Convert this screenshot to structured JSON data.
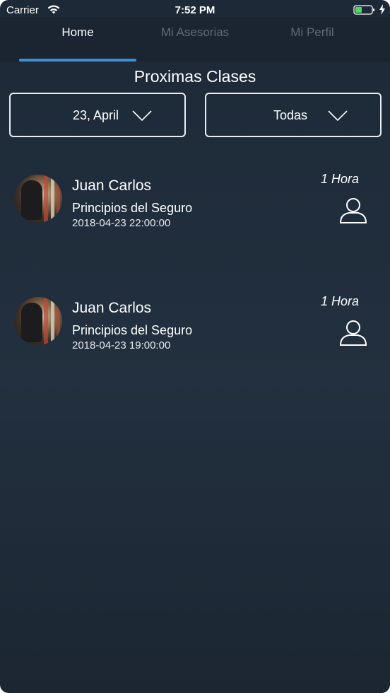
{
  "status_bar": {
    "carrier": "Carrier",
    "time": "7:52 PM",
    "icons": [
      "wifi-icon",
      "battery-icon",
      "charging-bolt-icon"
    ]
  },
  "tabs": [
    {
      "label": "Home",
      "active": true
    },
    {
      "label": "Mi Asesorias",
      "active": false
    },
    {
      "label": "Mi Perfil",
      "active": false
    }
  ],
  "page_title": "Proximas Clases",
  "filters": {
    "date": {
      "value": "23, April",
      "icon": "chevron-down-icon"
    },
    "category": {
      "value": "Todas",
      "icon": "chevron-down-icon"
    }
  },
  "classes": [
    {
      "teacher": "Juan Carlos",
      "course": "Principios del Seguro",
      "datetime": "2018-04-23 22:00:00",
      "duration": "1 Hora",
      "icon": "person-icon"
    },
    {
      "teacher": "Juan Carlos",
      "course": "Principios del Seguro",
      "datetime": "2018-04-23 19:00:00",
      "duration": "1 Hora",
      "icon": "person-icon"
    }
  ],
  "colors": {
    "background": "#1f2b38",
    "accent": "#3d8fd6",
    "inactive_tab": "#5d6a78"
  }
}
